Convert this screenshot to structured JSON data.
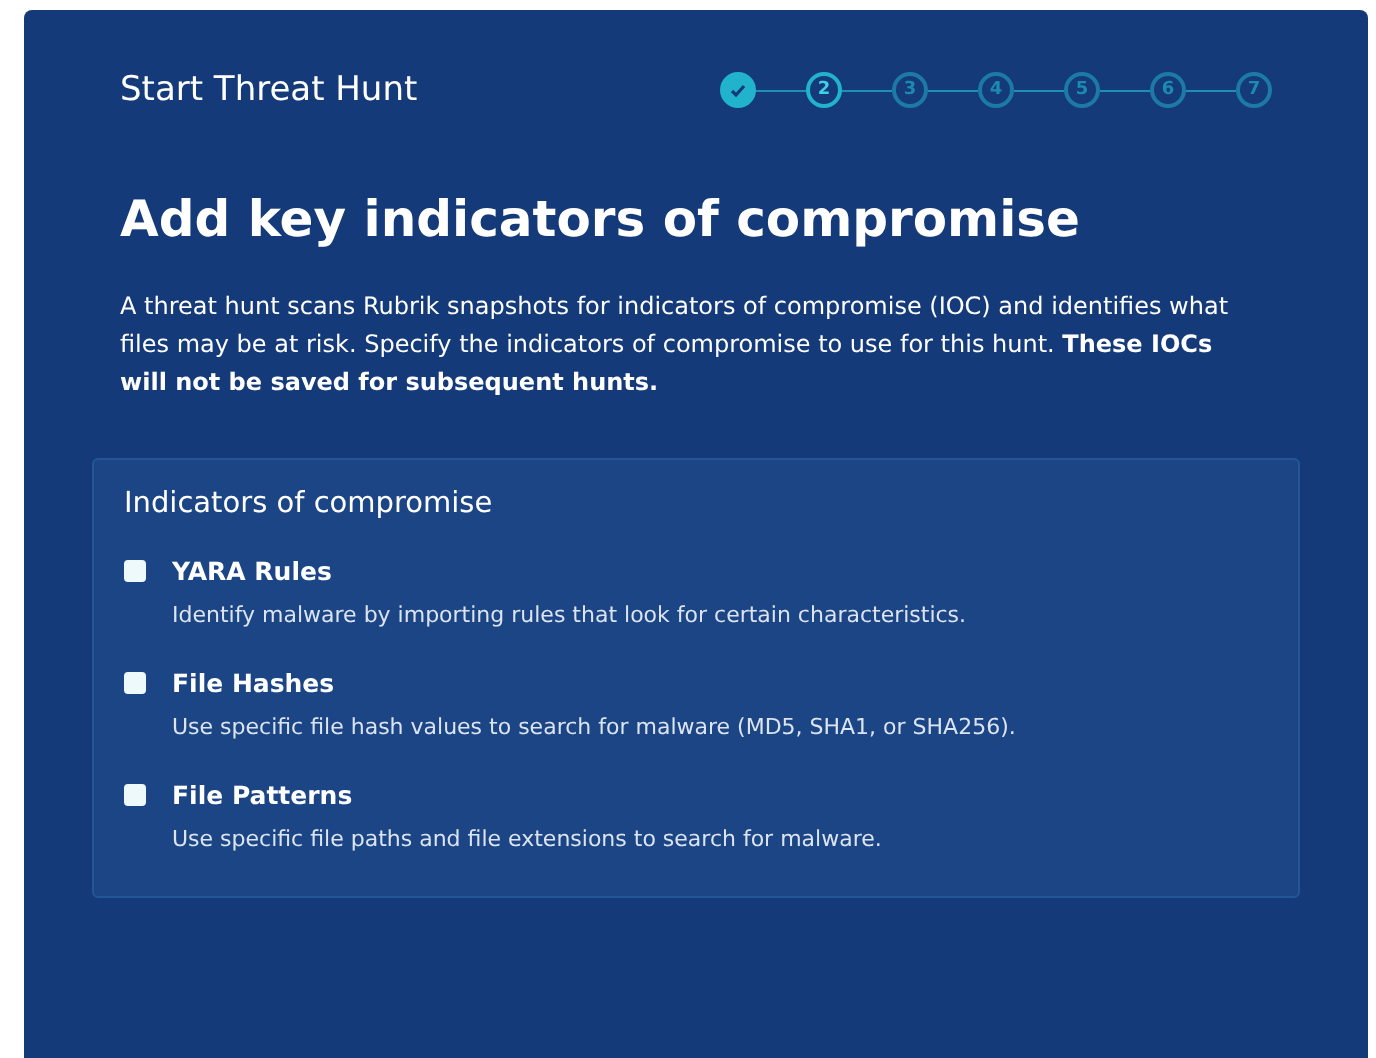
{
  "header": {
    "title": "Start Threat Hunt"
  },
  "steps": [
    {
      "kind": "done"
    },
    {
      "kind": "current",
      "label": "2"
    },
    {
      "kind": "upcoming",
      "label": "3"
    },
    {
      "kind": "upcoming",
      "label": "4"
    },
    {
      "kind": "upcoming",
      "label": "5"
    },
    {
      "kind": "upcoming",
      "label": "6"
    },
    {
      "kind": "upcoming",
      "label": "7"
    }
  ],
  "heading": "Add key indicators of compromise",
  "description": "A threat hunt scans Rubrik snapshots for indicators of compromise (IOC) and identifies what files may be at risk. Specify the indicators of compromise to use for this hunt. **These IOCs will not be saved for subsequent hunts.**",
  "panel": {
    "title": "Indicators of compromise",
    "options": [
      {
        "label": "YARA Rules",
        "description": "Identify malware by importing rules that look for certain characteristics.",
        "checked": false
      },
      {
        "label": "File Hashes",
        "description": "Use specific file hash values to search for malware (MD5, SHA1, or SHA256).",
        "checked": false
      },
      {
        "label": "File Patterns",
        "description": "Use specific file paths and file extensions to search for malware.",
        "checked": false
      }
    ]
  }
}
